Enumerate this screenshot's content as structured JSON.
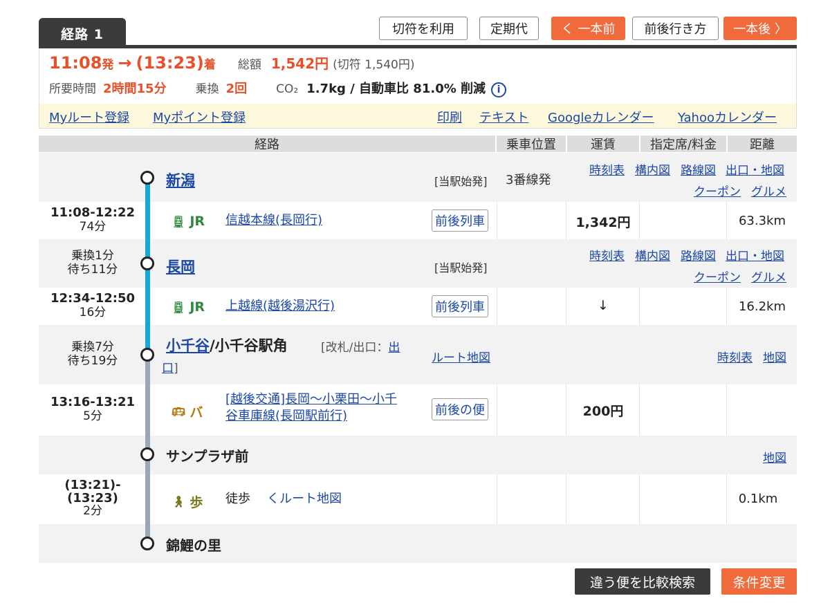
{
  "tabs": {
    "route": "経路 1"
  },
  "buttons": {
    "ticket": "切符を利用",
    "commuter": "定期代",
    "prev": "く 一本前",
    "around": "前後行き方",
    "next": "一本後 〉",
    "compare": "違う便を比較検索",
    "change": "条件変更"
  },
  "summary": {
    "dep_time": "11:08",
    "dep_suffix": "発",
    "arrow": "→",
    "arr_time": "(13:23)",
    "arr_suffix": "着",
    "total_label": "総額",
    "total": "1,542円",
    "ticket_note": "(切符 1,540円)",
    "duration_label": "所要時間",
    "duration": "2時間15分",
    "transfer_label": "乗換",
    "transfers": "2回",
    "co2_label": "CO₂",
    "co2": "1.7kg / 自動車比 81.0% 削減",
    "info": "i"
  },
  "links": {
    "my_route": "Myルート登録",
    "my_point": "Myポイント登録",
    "print": "印刷",
    "text": "テキスト",
    "google": "Googleカレンダー",
    "yahoo": "Yahooカレンダー"
  },
  "header": {
    "route": "経路",
    "position": "乗車位置",
    "fare": "運賃",
    "reserved": "指定席/料金",
    "distance": "距離"
  },
  "common": {
    "timetable": "時刻表",
    "station_map": "構内図",
    "line_map": "路線図",
    "exit_map": "出口・地図",
    "coupon": "クーポン",
    "gourmet": "グルメ",
    "map": "地図",
    "route_map": "ルート地図"
  },
  "stations": {
    "s1": {
      "name": "新潟",
      "note": "[当駅始発]",
      "platform": "3番線発"
    },
    "s2": {
      "name": "長岡",
      "note": "[当駅始発]",
      "wait1": "乗換1分",
      "wait2": "待ち11分"
    },
    "s3": {
      "name": "小千谷",
      "name_suffix": "/小千谷駅角",
      "note": "[改札/出口：",
      "exit1": "出",
      "exit2": "口",
      "note_end": "]",
      "wait1": "乗換7分",
      "wait2": "待ち19分"
    },
    "s4": {
      "name": "サンプラザ前"
    },
    "s5": {
      "name": "錦鯉の里"
    }
  },
  "legs": {
    "l1": {
      "time": "11:08-12:22",
      "mins": "74分",
      "mode": "JR",
      "line": "信越本線(長岡行)",
      "chip": "前後列車",
      "fare": "1,342円",
      "dist": "63.3km"
    },
    "l2": {
      "time": "12:34-12:50",
      "mins": "16分",
      "mode": "JR",
      "line": "上越線(越後湯沢行)",
      "chip": "前後列車",
      "fare": "↓",
      "dist": "16.2km"
    },
    "l3": {
      "time": "13:16-13:21",
      "mins": "5分",
      "mode": "バ",
      "line1": "[越後交通]長岡〜小栗田〜小千",
      "line2": "谷車庫線(長岡駅前行)",
      "chip": "前後の便",
      "fare": "200円"
    },
    "l4": {
      "time1": "(13:21)-",
      "time2": "(13:23)",
      "mins": "2分",
      "mode": "歩",
      "walk": "徒歩",
      "route": "くルート地図",
      "dist": "0.1km"
    }
  },
  "colors": {
    "accent": "#f06a3c",
    "jr_track": "#16a8d6",
    "bus_track": "#9aa7b4",
    "jr_green": "#2c8a3a"
  }
}
